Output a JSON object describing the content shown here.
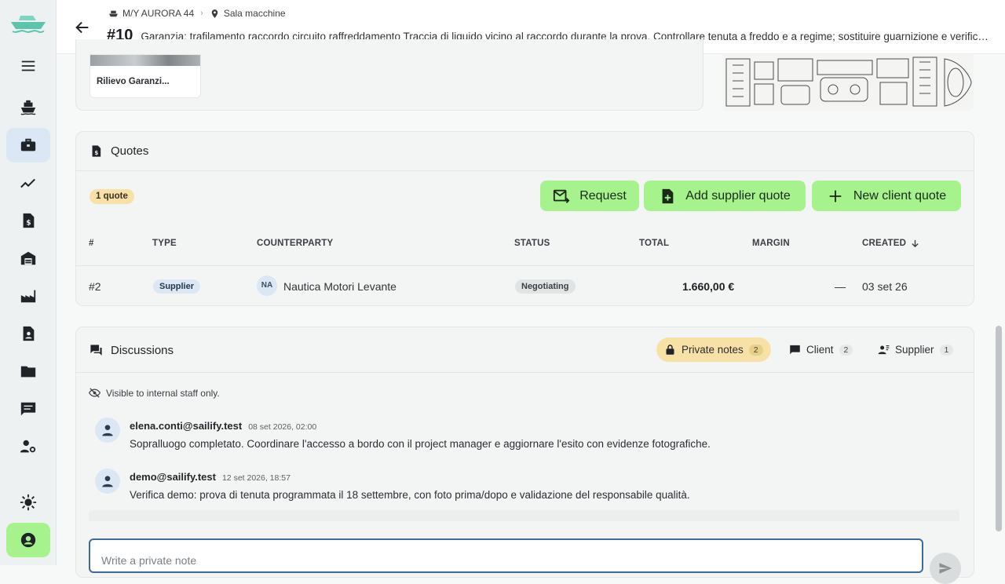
{
  "header": {
    "vessel": "M/Y AURORA 44",
    "location": "Sala macchine",
    "wo_number": "#10",
    "wo_title": "Garanzia: trafilamento raccordo circuito raffreddamento Traccia di liquido vicino al raccordo durante la prova. Controllare tenuta a freddo e a regime; sostituire guarnizione e verificare coppie di serraggio."
  },
  "attachments": {
    "first_label": "Rilievo Garanzi..."
  },
  "quotes": {
    "title": "Quotes",
    "count_badge": "1 quote",
    "buttons": {
      "request": "Request",
      "add_supplier": "Add supplier quote",
      "new_client": "New client quote"
    },
    "columns": [
      "#",
      "TYPE",
      "COUNTERPARTY",
      "STATUS",
      "TOTAL",
      "MARGIN",
      "CREATED"
    ],
    "rows": [
      {
        "num": "#2",
        "type": "Supplier",
        "initials": "NA",
        "counterparty": "Nautica Motori Levante",
        "status": "Negotiating",
        "total": "1.660,00 €",
        "margin": "—",
        "created": "03 set 26"
      }
    ]
  },
  "discussions": {
    "title": "Discussions",
    "tabs": [
      {
        "label": "Private notes",
        "count": "2"
      },
      {
        "label": "Client",
        "count": "2"
      },
      {
        "label": "Supplier",
        "count": "1"
      }
    ],
    "visibility_note": "Visible to internal staff only.",
    "messages": [
      {
        "author": "elena.conti@sailify.test",
        "time": "08 set 2026, 02:00",
        "text": "Sopralluogo completato. Coordinare l'accesso a bordo con il project manager e aggiornare l'esito con evidenze fotografiche."
      },
      {
        "author": "demo@sailify.test",
        "time": "12 set 2026, 18:57",
        "text": "Verifica demo: prova di tenuta programmata il 18 settembre, con foto prima/dopo e validazione del responsabile qualità."
      }
    ],
    "input_placeholder": "Write a private note"
  },
  "sidebar": {
    "icons": [
      "menu-icon",
      "ship-icon",
      "briefcase-icon",
      "trend-icon",
      "invoice-icon",
      "warehouse-icon",
      "factory-icon",
      "contact-document-icon",
      "folder-icon",
      "chat-icon",
      "user-settings-icon",
      "sun-icon",
      "account-icon"
    ]
  },
  "colors": {
    "accent_green": "#a6f28c",
    "active_blue": "#dbe7f5",
    "private_yellow": "#f7e1a6"
  }
}
